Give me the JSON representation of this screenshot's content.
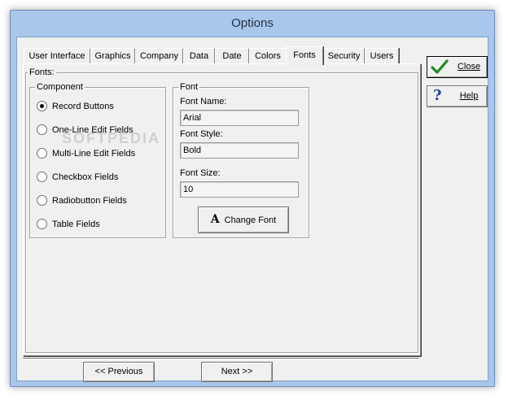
{
  "window": {
    "title": "Options"
  },
  "tabs": [
    {
      "label": "User Interface",
      "active": false
    },
    {
      "label": "Graphics",
      "active": false
    },
    {
      "label": "Company",
      "active": false
    },
    {
      "label": "Data",
      "active": false
    },
    {
      "label": "Date",
      "active": false
    },
    {
      "label": "Colors",
      "active": false
    },
    {
      "label": "Fonts",
      "active": true
    },
    {
      "label": "Security",
      "active": false
    },
    {
      "label": "Users",
      "active": false
    }
  ],
  "fonts_group": {
    "label": "Fonts:"
  },
  "component": {
    "label": "Component",
    "options": [
      {
        "label": "Record Buttons",
        "checked": true
      },
      {
        "label": "One-Line Edit Fields",
        "checked": false
      },
      {
        "label": "Multi-Line Edit Fields",
        "checked": false
      },
      {
        "label": "Checkbox Fields",
        "checked": false
      },
      {
        "label": "Radiobutton Fields",
        "checked": false
      },
      {
        "label": "Table Fields",
        "checked": false
      }
    ]
  },
  "font": {
    "label": "Font",
    "name_label": "Font Name:",
    "name_value": "Arial",
    "style_label": "Font Style:",
    "style_value": "Bold",
    "size_label": "Font Size:",
    "size_value": "10",
    "change_button": "Change Font",
    "change_icon_glyph": "A"
  },
  "side_buttons": {
    "close": "Close",
    "help": "Help",
    "help_icon_glyph": "?"
  },
  "navigation": {
    "previous": "<< Previous",
    "next": "Next >>"
  },
  "watermark": "SOFTPEDIA",
  "colors": {
    "frame": "#a9c7ea",
    "client": "#f0f0f0",
    "check": "#1f8a1f",
    "help": "#1a3f9e"
  }
}
